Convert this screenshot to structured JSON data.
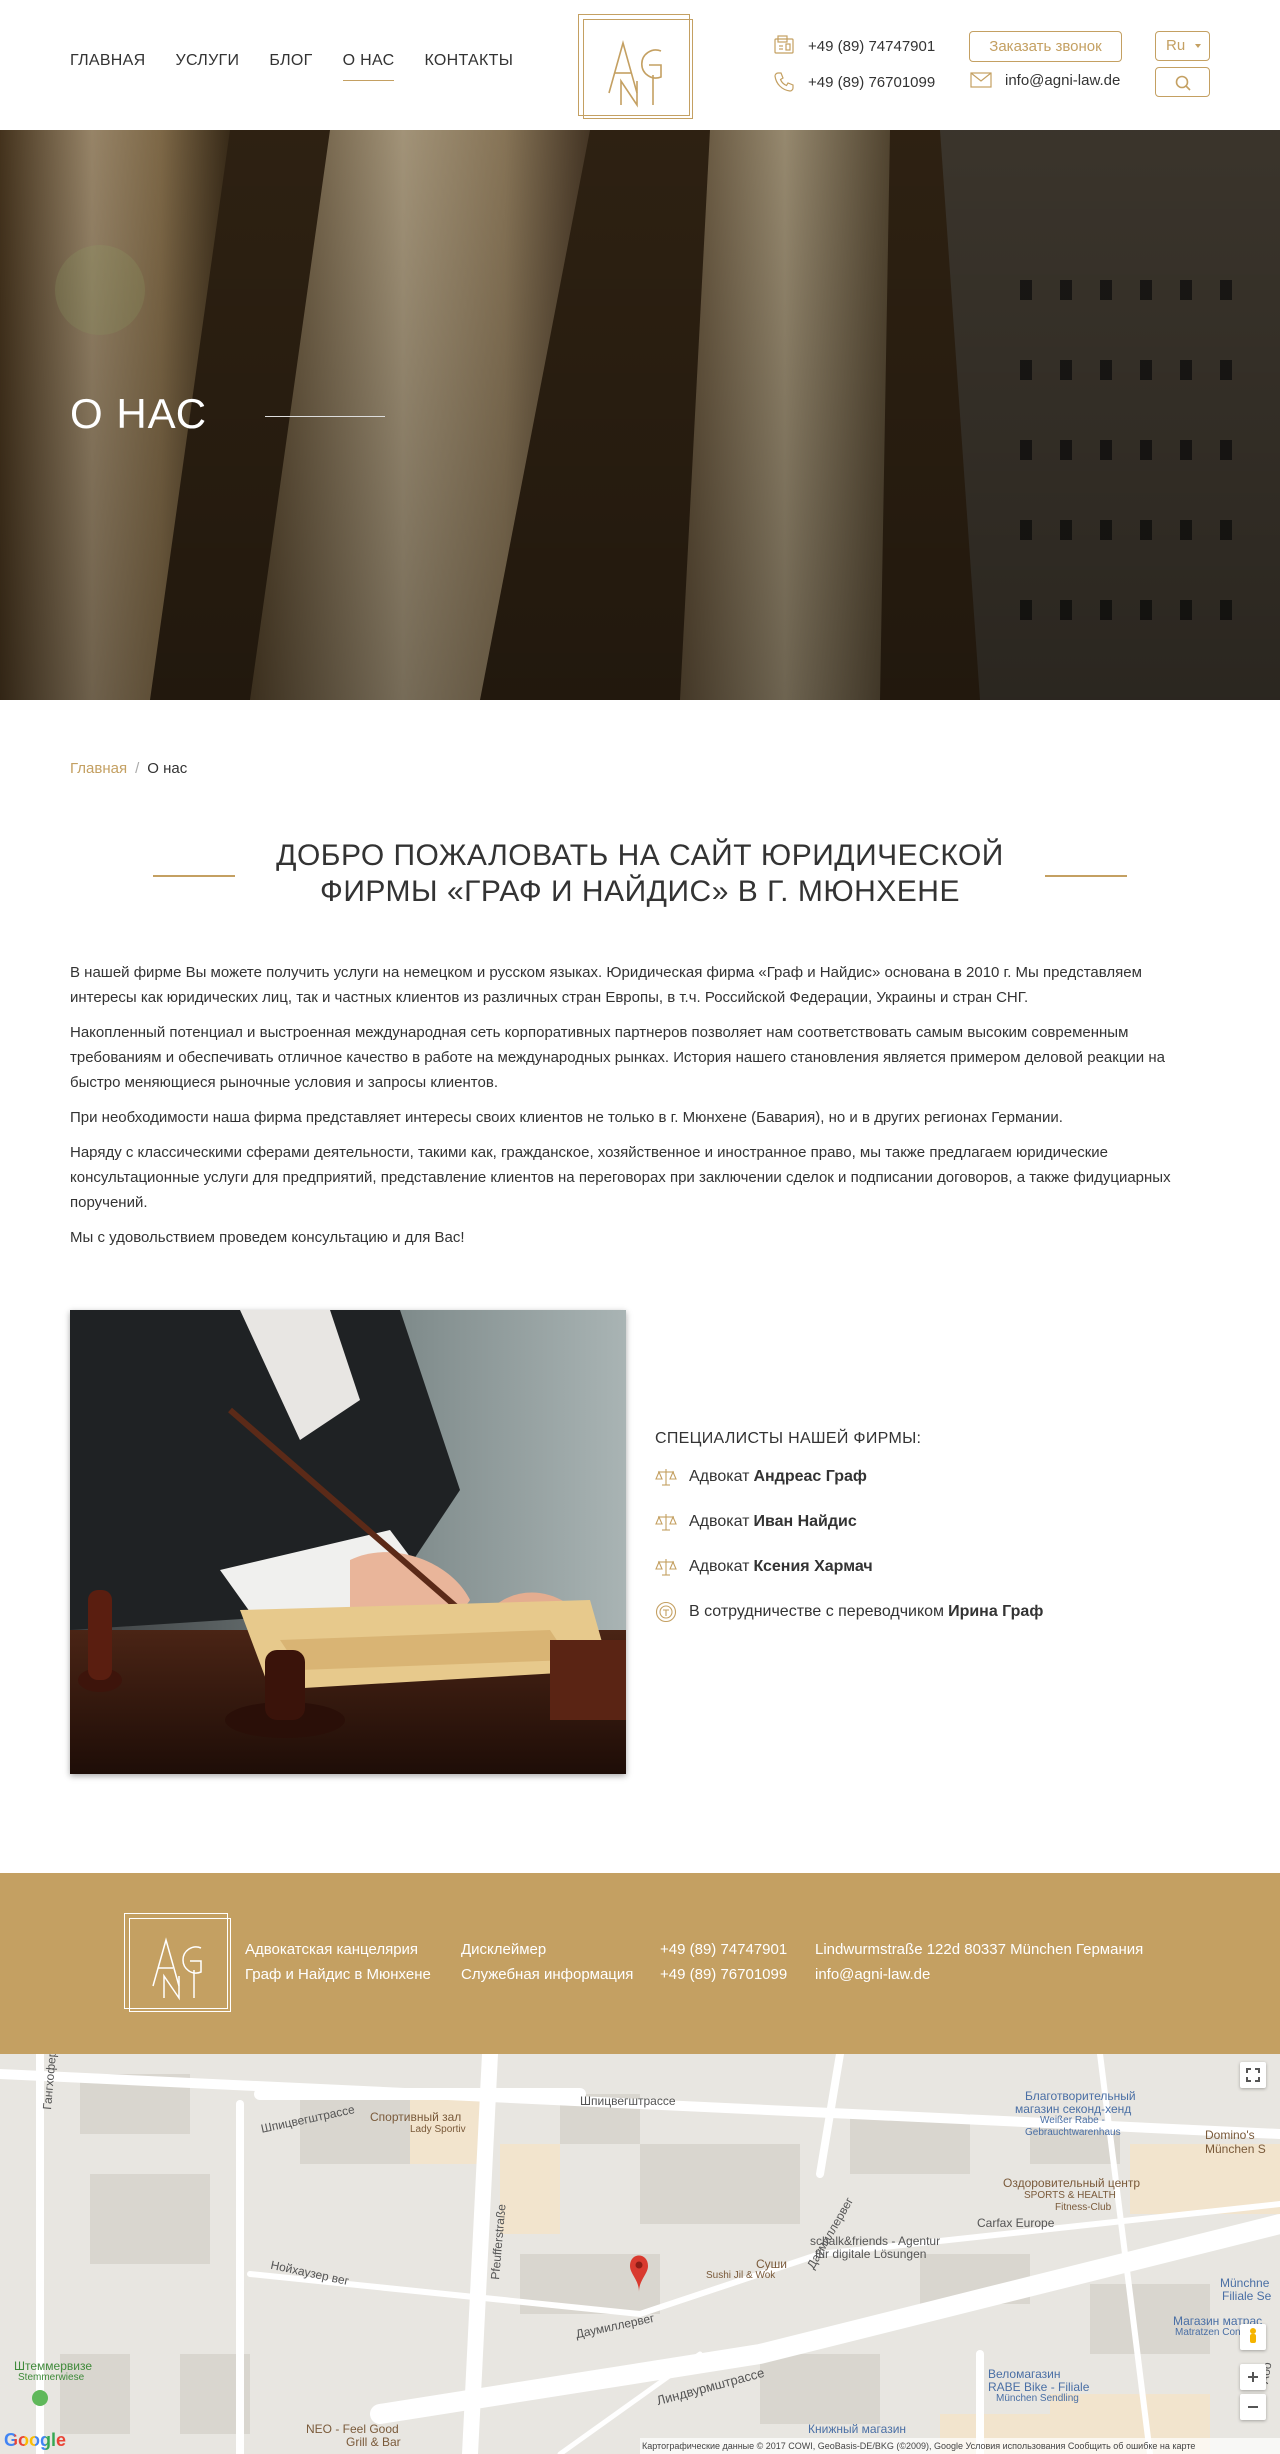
{
  "header": {
    "nav": [
      "ГЛАВНАЯ",
      "УСЛУГИ",
      "БЛОГ",
      "О НАС",
      "КОНТАКТЫ"
    ],
    "active_nav": "О НАС",
    "phone1": "+49 (89) 74747901",
    "phone2": "+49 (89) 76701099",
    "email": "info@agni-law.de",
    "callback_label": "Заказать звонок",
    "lang": "Ru"
  },
  "hero": {
    "title": "О НАС"
  },
  "breadcrumb": {
    "home": "Главная",
    "separator": "/",
    "current": "О нас"
  },
  "heading": "ДОБРО ПОЖАЛОВАТЬ НА САЙТ ЮРИДИЧЕСКОЙ ФИРМЫ «ГРАФ И НАЙДИС» В Г. МЮНХЕНЕ",
  "paragraphs": [
    "В нашей фирме Вы можете получить услуги на немецком и русском языках. Юридическая фирма «Граф и Найдис» основана в 2010 г. Мы представляем интересы как юридических лиц, так и частных клиентов из различных стран Европы, в т.ч. Российской Федерации, Украины и стран СНГ.",
    "Накопленный потенциал и выстроенная международная сеть корпоративных партнеров позволяет нам соответствовать самым высоким современным требованиям и обеспечивать отличное качество в работе на международных рынках. История нашего становления является примером деловой реакции на быстро меняющиеся рыночные условия и запросы клиентов.",
    "При необходимости наша фирма представляет интересы своих клиентов не только в г. Мюнхене (Бавария), но и в других регионах Германии.",
    "Наряду с классическими сферами деятельности, такими как, гражданское, хозяйственное и иностранное право, мы также предлагаем юридические консультационные услуги для предприятий, представление клиентов на переговорах при заключении сделок и подписании договоров, а также фидуциарных поручений.",
    "Мы с удовольствием проведем консультацию и для Вас!"
  ],
  "specialists": {
    "title": "СПЕЦИАЛИСТЫ НАШЕЙ ФИРМЫ:",
    "items": [
      {
        "prefix": "Адвокат",
        "name": "Андреас Граф",
        "icon": "scales-icon"
      },
      {
        "prefix": "Адвокат",
        "name": "Иван Найдис",
        "icon": "scales-icon"
      },
      {
        "prefix": "Адвокат",
        "name": "Ксения Хармач",
        "icon": "scales-icon"
      },
      {
        "prefix": "В сотрудничестве с переводчиком",
        "name": "Ирина Граф",
        "icon": "translator-icon"
      }
    ]
  },
  "footer": {
    "firm_line1": "Адвокатская канцелярия",
    "firm_line2": "Граф и Найдис в Мюнхене",
    "link1": "Дисклеймер",
    "link2": "Служебная информация",
    "phone1": "+49 (89) 74747901",
    "phone2": "+49 (89) 76701099",
    "address": "Lindwurmstraße 122d 80337 München Германия",
    "email": "info@agni-law.de"
  },
  "map": {
    "labels": {
      "spitz1": "Шпицвегштрассе",
      "spitz2": "Шпицвегштрассе",
      "pfeuffer": "Pfeufferstraße",
      "gangh": "Гангхоферштрассе",
      "neuhauser": "Нойхаузер вег",
      "daumiller": "Даумиллервег",
      "daumiller2": "Даумиллервег",
      "lindwurm": "Линдвурмштрассе",
      "sport_hall": "Спортивный зал",
      "sport_hall2": "Lady Sportiv",
      "charity1": "Благотворительный",
      "charity2": "магазин секонд-хенд",
      "charity3": "Weißer Rabe -",
      "charity4": "Gebrauchtwarenhaus",
      "dominos1": "Domino's",
      "dominos2": "München S",
      "health1": "Оздоровительный центр",
      "health2": "SPORTS & HEALTH",
      "health3": "Fitness-Club",
      "carfax": "Carfax Europe",
      "schalk1": "schalk&friends - Agentur",
      "schalk2": "für digitale Lösungen",
      "sushi1": "Суши",
      "sushi2": "Sushi Jil & Wok",
      "muenchner1": "Münchne",
      "muenchner2": "Filiale Se",
      "matratzen1": "Магазин матрас",
      "matratzen2": "Matratzen Concord",
      "rabe1": "Веломагазин",
      "rabe2": "RABE Bike - Filiale",
      "rabe3": "München Sendling",
      "book": "Книжный магазин",
      "neo1": "NEO - Feel Good",
      "neo2": "Grill & Bar",
      "stemm1": "Штеммервизе",
      "stemm2": "Stemmerwiese",
      "abo": "Або"
    },
    "footer": "Картографические данные © 2017 COWI, GeoBasis-DE/BKG (©2009), Google    Условия использования    Сообщить об ошибке на карте",
    "google_logo": "Google"
  }
}
